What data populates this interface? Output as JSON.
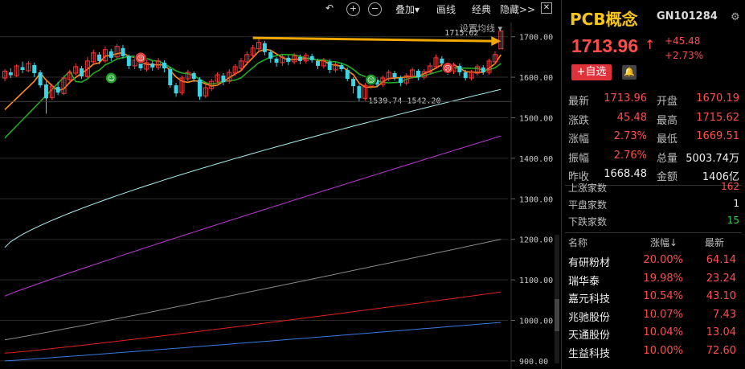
{
  "toolbar": {
    "undo_icon": "undo-icon",
    "zoom_in_icon": "zoom-in-icon",
    "zoom_out_icon": "zoom-out-icon",
    "overlay_label": "叠加▾",
    "draw_label": "画线",
    "classic_label": "经典",
    "hide_label": "隐藏>>",
    "close_icon": "close-icon"
  },
  "ma_setting_label": "设置均线",
  "price_axis": [
    "1700.00",
    "1600.00",
    "1500.00",
    "1400.00",
    "1300.00",
    "1200.00",
    "1100.00",
    "1000.00",
    "900.00"
  ],
  "annotations": {
    "high_label": "1715.62",
    "low_label": "1539.74",
    "low_label2": "1542.20"
  },
  "chart_data": {
    "type": "candlestick",
    "y_axis": {
      "min": 880,
      "max": 1735,
      "ticks": [
        1700,
        1600,
        1500,
        1400,
        1300,
        1200,
        1100,
        1000,
        900
      ]
    },
    "candles": [
      [
        1598,
        1615,
        1590,
        1620
      ],
      [
        1612,
        1605,
        1598,
        1622
      ],
      [
        1604,
        1628,
        1600,
        1632
      ],
      [
        1625,
        1618,
        1610,
        1638
      ],
      [
        1616,
        1634,
        1612,
        1640
      ],
      [
        1630,
        1610,
        1600,
        1636
      ],
      [
        1612,
        1580,
        1574,
        1618
      ],
      [
        1582,
        1548,
        1510,
        1590
      ],
      [
        1550,
        1578,
        1544,
        1584
      ],
      [
        1576,
        1562,
        1556,
        1588
      ],
      [
        1560,
        1598,
        1556,
        1604
      ],
      [
        1594,
        1612,
        1588,
        1618
      ],
      [
        1610,
        1626,
        1604,
        1634
      ],
      [
        1622,
        1602,
        1596,
        1628
      ],
      [
        1602,
        1640,
        1598,
        1650
      ],
      [
        1638,
        1660,
        1632,
        1668
      ],
      [
        1656,
        1640,
        1632,
        1662
      ],
      [
        1640,
        1668,
        1636,
        1676
      ],
      [
        1664,
        1648,
        1640,
        1670
      ],
      [
        1650,
        1676,
        1644,
        1682
      ],
      [
        1672,
        1652,
        1646,
        1680
      ],
      [
        1652,
        1628,
        1620,
        1656
      ],
      [
        1628,
        1642,
        1620,
        1650
      ],
      [
        1640,
        1622,
        1616,
        1646
      ],
      [
        1620,
        1636,
        1614,
        1644
      ],
      [
        1634,
        1624,
        1616,
        1640
      ],
      [
        1624,
        1640,
        1618,
        1648
      ],
      [
        1636,
        1622,
        1612,
        1642
      ],
      [
        1620,
        1580,
        1574,
        1626
      ],
      [
        1580,
        1560,
        1552,
        1586
      ],
      [
        1562,
        1598,
        1556,
        1604
      ],
      [
        1596,
        1612,
        1590,
        1618
      ],
      [
        1610,
        1596,
        1588,
        1614
      ],
      [
        1594,
        1552,
        1544,
        1600
      ],
      [
        1554,
        1574,
        1548,
        1582
      ],
      [
        1572,
        1590,
        1566,
        1596
      ],
      [
        1590,
        1606,
        1584,
        1612
      ],
      [
        1604,
        1588,
        1580,
        1610
      ],
      [
        1590,
        1612,
        1584,
        1620
      ],
      [
        1610,
        1626,
        1604,
        1632
      ],
      [
        1622,
        1640,
        1616,
        1648
      ],
      [
        1638,
        1656,
        1630,
        1664
      ],
      [
        1654,
        1672,
        1648,
        1680
      ],
      [
        1670,
        1686,
        1664,
        1694
      ],
      [
        1684,
        1662,
        1654,
        1690
      ],
      [
        1662,
        1646,
        1636,
        1668
      ],
      [
        1646,
        1636,
        1626,
        1650
      ],
      [
        1636,
        1650,
        1628,
        1658
      ],
      [
        1648,
        1638,
        1630,
        1654
      ],
      [
        1638,
        1652,
        1632,
        1660
      ],
      [
        1650,
        1640,
        1632,
        1656
      ],
      [
        1640,
        1654,
        1634,
        1660
      ],
      [
        1652,
        1642,
        1636,
        1658
      ],
      [
        1640,
        1628,
        1620,
        1646
      ],
      [
        1628,
        1640,
        1622,
        1648
      ],
      [
        1638,
        1618,
        1610,
        1644
      ],
      [
        1618,
        1632,
        1612,
        1638
      ],
      [
        1630,
        1620,
        1614,
        1636
      ],
      [
        1618,
        1596,
        1590,
        1624
      ],
      [
        1596,
        1578,
        1560,
        1600
      ],
      [
        1578,
        1548,
        1540,
        1582
      ],
      [
        1548,
        1580,
        1542,
        1586
      ],
      [
        1578,
        1596,
        1572,
        1602
      ],
      [
        1594,
        1582,
        1576,
        1600
      ],
      [
        1582,
        1598,
        1576,
        1604
      ],
      [
        1596,
        1612,
        1590,
        1618
      ],
      [
        1610,
        1600,
        1592,
        1616
      ],
      [
        1598,
        1586,
        1578,
        1604
      ],
      [
        1586,
        1604,
        1580,
        1610
      ],
      [
        1602,
        1618,
        1596,
        1624
      ],
      [
        1616,
        1600,
        1592,
        1620
      ],
      [
        1600,
        1614,
        1594,
        1620
      ],
      [
        1612,
        1628,
        1606,
        1636
      ],
      [
        1626,
        1648,
        1620,
        1656
      ],
      [
        1646,
        1634,
        1626,
        1652
      ],
      [
        1632,
        1614,
        1606,
        1638
      ],
      [
        1614,
        1630,
        1608,
        1636
      ],
      [
        1628,
        1612,
        1604,
        1634
      ],
      [
        1612,
        1598,
        1592,
        1618
      ],
      [
        1598,
        1612,
        1592,
        1618
      ],
      [
        1610,
        1626,
        1604,
        1632
      ],
      [
        1624,
        1612,
        1606,
        1630
      ],
      [
        1612,
        1640,
        1606,
        1646
      ],
      [
        1638,
        1656,
        1632,
        1664
      ],
      [
        1670,
        1714,
        1670,
        1716
      ]
    ],
    "ma_lines": [
      {
        "color": "#ff8c1a",
        "values_start": 1540,
        "shape": "ma5"
      },
      {
        "color": "#22aa22",
        "values_start": 1450,
        "shape": "ma10"
      },
      {
        "color": "#aaf0f0",
        "values_start": 1180,
        "shape": "ma20"
      },
      {
        "color": "#c038d8",
        "values_start": 1060,
        "shape": "ma60"
      },
      {
        "color": "#888888",
        "values_start": 950,
        "shape": "ma120"
      },
      {
        "color": "#e02020",
        "values_start": 920,
        "shape": "ma250"
      },
      {
        "color": "#3a7ae0",
        "values_start": 900,
        "shape": "ma500"
      }
    ],
    "signals": [
      {
        "type": "buy",
        "price": 1598,
        "index": 18
      },
      {
        "type": "sell",
        "price": 1648,
        "index": 23
      },
      {
        "type": "buy",
        "price": 1594,
        "index": 62
      },
      {
        "type": "sell",
        "price": 1623,
        "index": 75
      }
    ]
  },
  "panel": {
    "name": "PCB概念",
    "code": "GN101284",
    "settings_icon": "settings-icon",
    "price": "1713.96",
    "arrow": "↑",
    "change": "+45.48",
    "change_pct": "+2.73%",
    "fav_label": "+自选",
    "alert_icon": "bell-icon",
    "stats": [
      {
        "l1": "最新",
        "v1": "1713.96",
        "c1": "red",
        "l2": "开盘",
        "v2": "1670.19",
        "c2": "red"
      },
      {
        "l1": "涨跌",
        "v1": "45.48",
        "c1": "red",
        "l2": "最高",
        "v2": "1715.62",
        "c2": "red"
      },
      {
        "l1": "涨幅",
        "v1": "2.73%",
        "c1": "red",
        "l2": "最低",
        "v2": "1669.51",
        "c2": "red"
      },
      {
        "l1": "振幅",
        "v1": "2.76%",
        "c1": "red",
        "l2": "总量",
        "v2": "5003.74万",
        "c2": "wht"
      },
      {
        "l1": "昨收",
        "v1": "1668.48",
        "c1": "wht",
        "l2": "金额",
        "v2": "1406亿",
        "c2": "wht"
      }
    ],
    "counts": [
      {
        "label": "上涨家数",
        "value": "162",
        "color": "red"
      },
      {
        "label": "平盘家数",
        "value": "1",
        "color": "wht"
      },
      {
        "label": "下跌家数",
        "value": "15",
        "color": "grn"
      }
    ],
    "table_head": {
      "name": "名称",
      "pct": "涨幅↓",
      "price": "最新"
    },
    "table_rows": [
      {
        "name": "有研粉材",
        "pct": "20.00%",
        "price": "64.14"
      },
      {
        "name": "瑞华泰",
        "pct": "19.98%",
        "price": "23.24"
      },
      {
        "name": "嘉元科技",
        "pct": "10.54%",
        "price": "43.10"
      },
      {
        "name": "兆驰股份",
        "pct": "10.07%",
        "price": "7.43"
      },
      {
        "name": "天通股份",
        "pct": "10.04%",
        "price": "13.04"
      },
      {
        "name": "生益科技",
        "pct": "10.00%",
        "price": "72.60"
      }
    ]
  }
}
